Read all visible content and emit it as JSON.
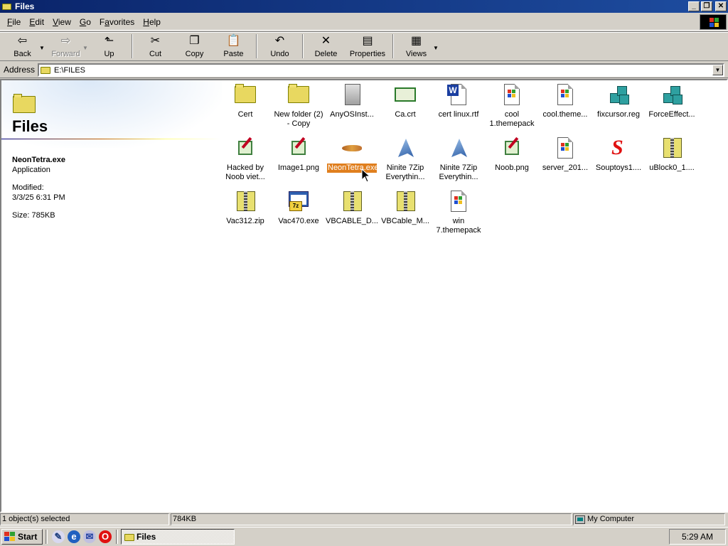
{
  "window": {
    "title": "Files",
    "controls": {
      "minimize": "_",
      "maximize": "❐",
      "close": "✕"
    }
  },
  "menu": [
    {
      "label": "File",
      "u": "F",
      "rest": "ile"
    },
    {
      "label": "Edit",
      "u": "E",
      "rest": "dit"
    },
    {
      "label": "View",
      "u": "V",
      "rest": "iew"
    },
    {
      "label": "Go",
      "u": "G",
      "rest": "o"
    },
    {
      "label": "Favorites",
      "u": "a",
      "pre": "F",
      "rest": "vorites"
    },
    {
      "label": "Help",
      "u": "H",
      "rest": "elp"
    }
  ],
  "toolbar": {
    "back": "Back",
    "forward": "Forward",
    "up": "Up",
    "cut": "Cut",
    "copy": "Copy",
    "paste": "Paste",
    "undo": "Undo",
    "delete": "Delete",
    "properties": "Properties",
    "views": "Views"
  },
  "address": {
    "label": "Address",
    "value": "E:\\FILES"
  },
  "webview": {
    "folder_title": "Files",
    "selected_name": "NeonTetra.exe",
    "selected_type": "Application",
    "modified_label": "Modified:",
    "modified_value": "3/3/25 6:31 PM",
    "size": "Size: 785KB"
  },
  "files": [
    {
      "label": "Cert",
      "icon": "folder-icon"
    },
    {
      "label": "New folder (2) - Copy",
      "icon": "folder-icon"
    },
    {
      "label": "AnyOSInst...",
      "icon": "installer-icon"
    },
    {
      "label": "Ca.crt",
      "icon": "certificate-icon"
    },
    {
      "label": "cert linux.rtf",
      "icon": "word-document-icon"
    },
    {
      "label": "cool 1.themepack",
      "icon": "themepack-icon"
    },
    {
      "label": "cool.theme...",
      "icon": "themepack-icon"
    },
    {
      "label": "fixcursor.reg",
      "icon": "registry-icon"
    },
    {
      "label": "ForceEffect...",
      "icon": "registry-icon"
    },
    {
      "label": "Hacked by Noob viet...",
      "icon": "image-icon"
    },
    {
      "label": "Image1.png",
      "icon": "image-icon"
    },
    {
      "label": "NeonTetra.exe",
      "icon": "fish-icon"
    },
    {
      "label": "Ninite 7Zip Everythin...",
      "icon": "ninite-icon"
    },
    {
      "label": "Ninite 7Zip Everythin...",
      "icon": "ninite-icon"
    },
    {
      "label": "Noob.png",
      "icon": "image-icon"
    },
    {
      "label": "server_201...",
      "icon": "themepack-icon"
    },
    {
      "label": "Souptoys1....",
      "icon": "souptoys-icon"
    },
    {
      "label": "uBlock0_1....",
      "icon": "zip-icon"
    },
    {
      "label": "Vac312.zip",
      "icon": "zip-icon"
    },
    {
      "label": "Vac470.exe",
      "icon": "7zip-exe-icon"
    },
    {
      "label": "VBCABLE_D...",
      "icon": "zip-icon"
    },
    {
      "label": "VBCable_M...",
      "icon": "zip-icon"
    },
    {
      "label": "win 7.themepack",
      "icon": "themepack-icon"
    }
  ],
  "status": {
    "selection": "1 object(s) selected",
    "size": "784KB",
    "zone": "My Computer"
  },
  "taskbar": {
    "start": "Start",
    "task": "Files",
    "clock": "5:29 AM"
  },
  "colors": {
    "titlebar": "#0a246a",
    "selection": "#e07f1e",
    "chrome": "#d4d0c8"
  }
}
